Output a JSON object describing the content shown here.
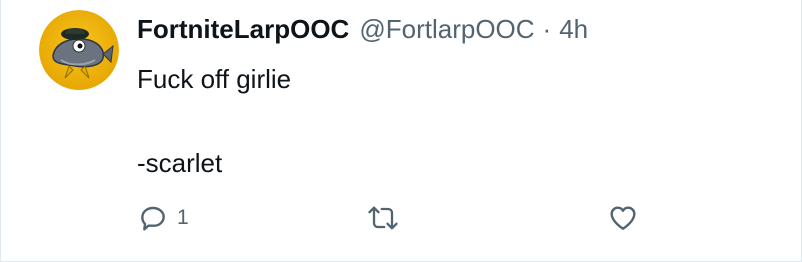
{
  "tweet": {
    "display_name": "FortniteLarpOOC",
    "handle": "@FortlarpOOC",
    "separator": "·",
    "time": "4h",
    "body_lines": [
      "Fuck off girlie",
      "",
      "-scarlet"
    ],
    "avatar_icon": "fish-character-avatar"
  },
  "actions": {
    "reply": {
      "icon": "reply-icon",
      "count": "1"
    },
    "retweet": {
      "icon": "retweet-icon",
      "count": ""
    },
    "like": {
      "icon": "heart-icon",
      "count": ""
    }
  },
  "colors": {
    "text_primary": "#0f1419",
    "text_secondary": "#536471",
    "avatar_bg": "#f2b705",
    "border": "#e1e8ed"
  }
}
